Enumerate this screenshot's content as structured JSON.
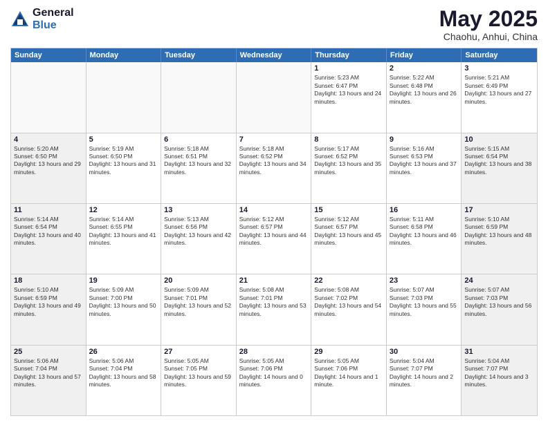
{
  "logo": {
    "general": "General",
    "blue": "Blue"
  },
  "title": "May 2025",
  "subtitle": "Chaohu, Anhui, China",
  "header_days": [
    "Sunday",
    "Monday",
    "Tuesday",
    "Wednesday",
    "Thursday",
    "Friday",
    "Saturday"
  ],
  "rows": [
    [
      {
        "day": "",
        "empty": true
      },
      {
        "day": "",
        "empty": true
      },
      {
        "day": "",
        "empty": true
      },
      {
        "day": "",
        "empty": true
      },
      {
        "day": "1",
        "sunrise": "5:23 AM",
        "sunset": "6:47 PM",
        "daylight": "13 hours and 24 minutes."
      },
      {
        "day": "2",
        "sunrise": "5:22 AM",
        "sunset": "6:48 PM",
        "daylight": "13 hours and 26 minutes."
      },
      {
        "day": "3",
        "sunrise": "5:21 AM",
        "sunset": "6:49 PM",
        "daylight": "13 hours and 27 minutes."
      }
    ],
    [
      {
        "day": "4",
        "shaded": true,
        "sunrise": "5:20 AM",
        "sunset": "6:50 PM",
        "daylight": "13 hours and 29 minutes."
      },
      {
        "day": "5",
        "sunrise": "5:19 AM",
        "sunset": "6:50 PM",
        "daylight": "13 hours and 31 minutes."
      },
      {
        "day": "6",
        "sunrise": "5:18 AM",
        "sunset": "6:51 PM",
        "daylight": "13 hours and 32 minutes."
      },
      {
        "day": "7",
        "sunrise": "5:18 AM",
        "sunset": "6:52 PM",
        "daylight": "13 hours and 34 minutes."
      },
      {
        "day": "8",
        "sunrise": "5:17 AM",
        "sunset": "6:52 PM",
        "daylight": "13 hours and 35 minutes."
      },
      {
        "day": "9",
        "sunrise": "5:16 AM",
        "sunset": "6:53 PM",
        "daylight": "13 hours and 37 minutes."
      },
      {
        "day": "10",
        "shaded": true,
        "sunrise": "5:15 AM",
        "sunset": "6:54 PM",
        "daylight": "13 hours and 38 minutes."
      }
    ],
    [
      {
        "day": "11",
        "shaded": true,
        "sunrise": "5:14 AM",
        "sunset": "6:54 PM",
        "daylight": "13 hours and 40 minutes."
      },
      {
        "day": "12",
        "sunrise": "5:14 AM",
        "sunset": "6:55 PM",
        "daylight": "13 hours and 41 minutes."
      },
      {
        "day": "13",
        "sunrise": "5:13 AM",
        "sunset": "6:56 PM",
        "daylight": "13 hours and 42 minutes."
      },
      {
        "day": "14",
        "sunrise": "5:12 AM",
        "sunset": "6:57 PM",
        "daylight": "13 hours and 44 minutes."
      },
      {
        "day": "15",
        "sunrise": "5:12 AM",
        "sunset": "6:57 PM",
        "daylight": "13 hours and 45 minutes."
      },
      {
        "day": "16",
        "sunrise": "5:11 AM",
        "sunset": "6:58 PM",
        "daylight": "13 hours and 46 minutes."
      },
      {
        "day": "17",
        "shaded": true,
        "sunrise": "5:10 AM",
        "sunset": "6:59 PM",
        "daylight": "13 hours and 48 minutes."
      }
    ],
    [
      {
        "day": "18",
        "shaded": true,
        "sunrise": "5:10 AM",
        "sunset": "6:59 PM",
        "daylight": "13 hours and 49 minutes."
      },
      {
        "day": "19",
        "sunrise": "5:09 AM",
        "sunset": "7:00 PM",
        "daylight": "13 hours and 50 minutes."
      },
      {
        "day": "20",
        "sunrise": "5:09 AM",
        "sunset": "7:01 PM",
        "daylight": "13 hours and 52 minutes."
      },
      {
        "day": "21",
        "sunrise": "5:08 AM",
        "sunset": "7:01 PM",
        "daylight": "13 hours and 53 minutes."
      },
      {
        "day": "22",
        "sunrise": "5:08 AM",
        "sunset": "7:02 PM",
        "daylight": "13 hours and 54 minutes."
      },
      {
        "day": "23",
        "sunrise": "5:07 AM",
        "sunset": "7:03 PM",
        "daylight": "13 hours and 55 minutes."
      },
      {
        "day": "24",
        "shaded": true,
        "sunrise": "5:07 AM",
        "sunset": "7:03 PM",
        "daylight": "13 hours and 56 minutes."
      }
    ],
    [
      {
        "day": "25",
        "shaded": true,
        "sunrise": "5:06 AM",
        "sunset": "7:04 PM",
        "daylight": "13 hours and 57 minutes."
      },
      {
        "day": "26",
        "sunrise": "5:06 AM",
        "sunset": "7:04 PM",
        "daylight": "13 hours and 58 minutes."
      },
      {
        "day": "27",
        "sunrise": "5:05 AM",
        "sunset": "7:05 PM",
        "daylight": "13 hours and 59 minutes."
      },
      {
        "day": "28",
        "sunrise": "5:05 AM",
        "sunset": "7:06 PM",
        "daylight": "14 hours and 0 minutes."
      },
      {
        "day": "29",
        "sunrise": "5:05 AM",
        "sunset": "7:06 PM",
        "daylight": "14 hours and 1 minute."
      },
      {
        "day": "30",
        "sunrise": "5:04 AM",
        "sunset": "7:07 PM",
        "daylight": "14 hours and 2 minutes."
      },
      {
        "day": "31",
        "shaded": true,
        "sunrise": "5:04 AM",
        "sunset": "7:07 PM",
        "daylight": "14 hours and 3 minutes."
      }
    ]
  ]
}
